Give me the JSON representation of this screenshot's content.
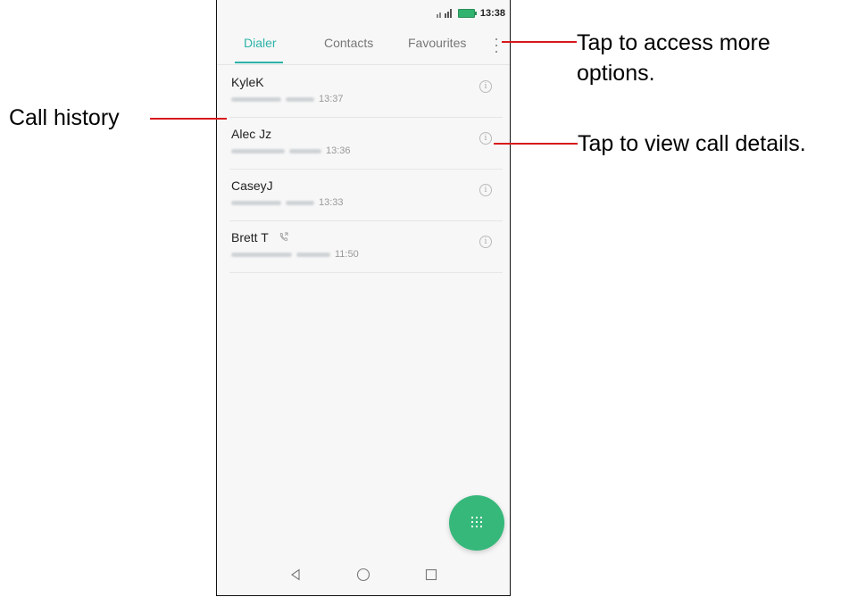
{
  "status_bar": {
    "time": "13:38"
  },
  "tabs": [
    {
      "label": "Dialer",
      "active": true
    },
    {
      "label": "Contacts",
      "active": false
    },
    {
      "label": "Favourites",
      "active": false
    }
  ],
  "calls": [
    {
      "name": "KyleK",
      "time": "13:37",
      "outgoing": false
    },
    {
      "name": "Alec Jz",
      "time": "13:36",
      "outgoing": false
    },
    {
      "name": "CaseyJ",
      "time": "13:33",
      "outgoing": false
    },
    {
      "name": "Brett T",
      "time": "11:50",
      "outgoing": true
    }
  ],
  "callouts": {
    "more_options": "Tap to access more options.",
    "call_history": "Call history",
    "call_details": "Tap to view call details."
  },
  "colors": {
    "accent": "#2bb3a8",
    "fab": "#36b87a",
    "callout_line": "#d7191c"
  },
  "icons": [
    "more-options-icon",
    "info-icon",
    "outgoing-call-icon",
    "dialpad-icon",
    "back-icon",
    "home-icon",
    "recents-icon"
  ]
}
